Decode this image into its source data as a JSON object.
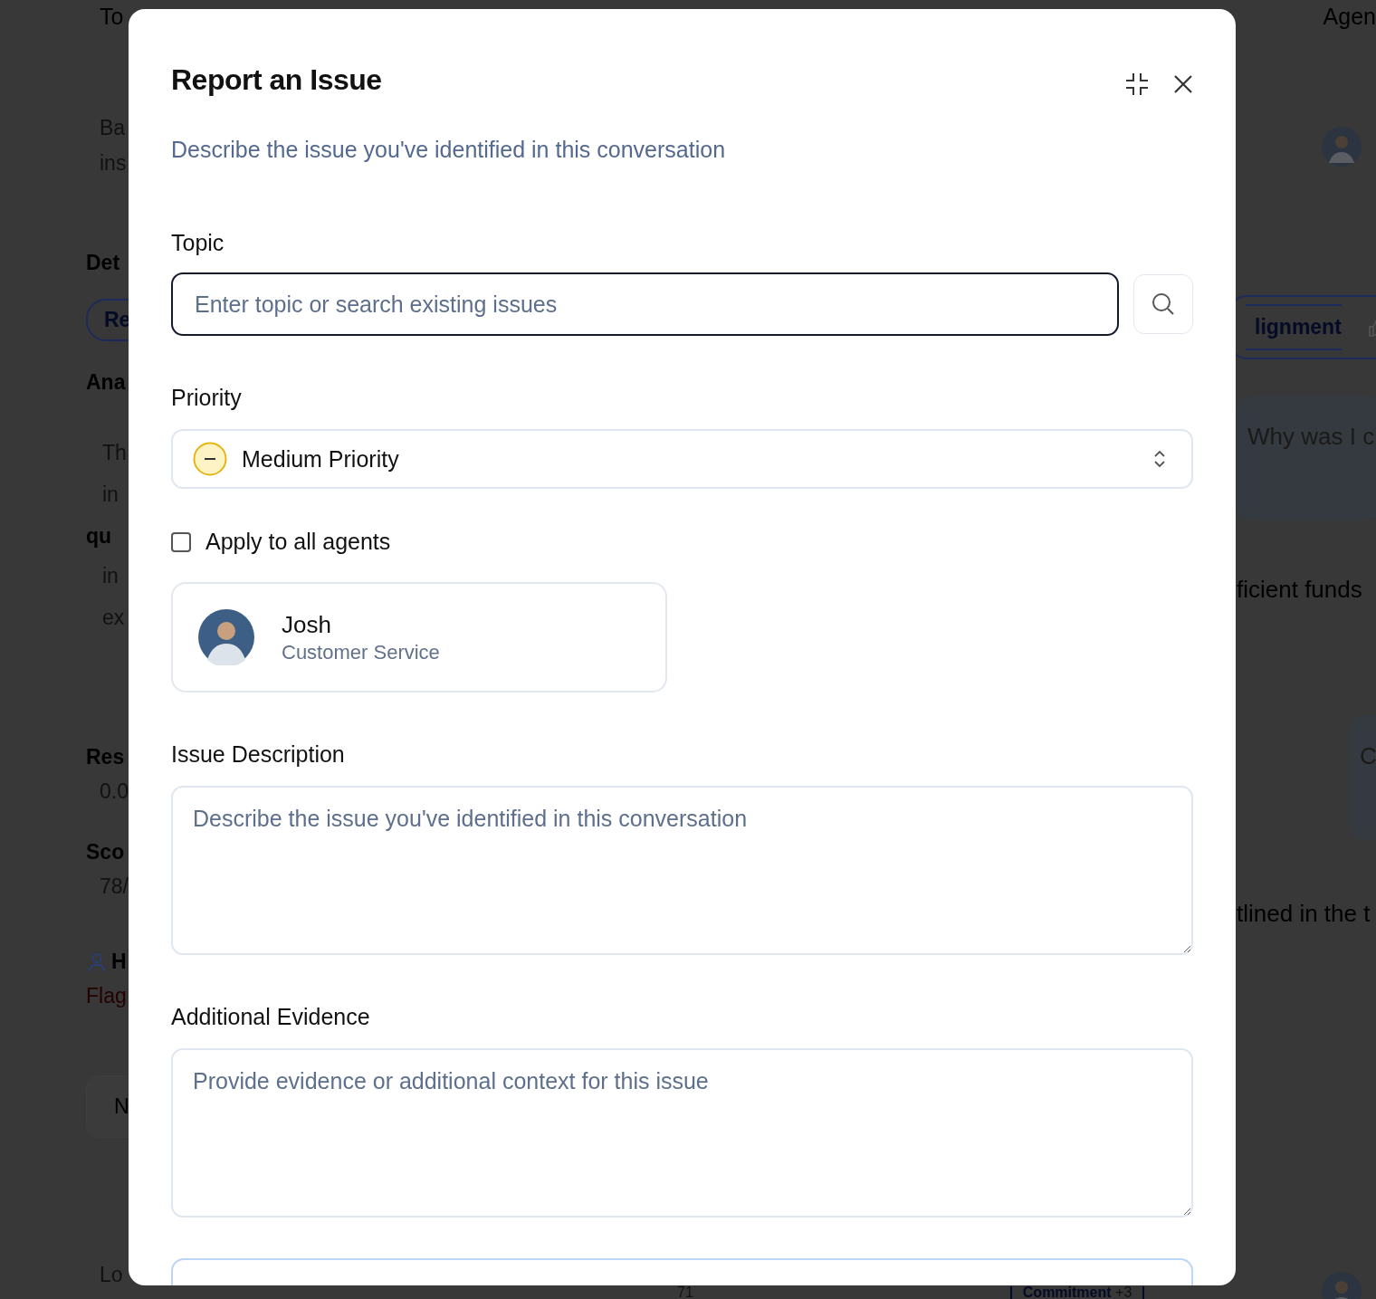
{
  "background": {
    "header": [
      {
        "text": "To"
      },
      {
        "text": "Agen"
      }
    ],
    "left": [
      {
        "text": "Ba",
        "kind": "text"
      },
      {
        "text": "ins",
        "kind": "text"
      },
      {
        "text": "Det",
        "kind": "heading"
      },
      {
        "text": "Re",
        "kind": "pill"
      },
      {
        "text": "Ana",
        "kind": "heading"
      },
      {
        "text": "Th",
        "kind": "para"
      },
      {
        "text": "in",
        "kind": "para"
      },
      {
        "text": "qu",
        "kind": "bold"
      },
      {
        "text": "in",
        "kind": "para"
      },
      {
        "text": "ex",
        "kind": "para"
      },
      {
        "text": "Res",
        "kind": "heading"
      },
      {
        "text": "0.0",
        "kind": "text"
      },
      {
        "text": "Sco",
        "kind": "heading"
      },
      {
        "text": "78/",
        "kind": "text"
      },
      {
        "text": "H",
        "kind": "person"
      },
      {
        "text": "Flag",
        "kind": "alert"
      },
      {
        "text": "N",
        "kind": "button"
      },
      {
        "text": "Lo",
        "kind": "text"
      }
    ],
    "right": [
      {
        "kind": "avatar"
      },
      {
        "text": "lignment",
        "kind": "pill"
      },
      {
        "text": "Why was I c",
        "kind": "card"
      },
      {
        "text": "ficient funds",
        "kind": "text"
      },
      {
        "text": "C",
        "kind": "card"
      },
      {
        "text": "tlined in the t",
        "kind": "text"
      },
      {
        "kind": "avatar"
      }
    ],
    "bottom": [
      {
        "text": "71",
        "kind": "text"
      },
      {
        "text": "Commitment",
        "count": "+3",
        "kind": "pill"
      }
    ]
  },
  "modal": {
    "title": "Report an Issue",
    "subtitle": "Describe the issue you've identified in this conversation",
    "topic": {
      "label": "Topic",
      "placeholder": "Enter topic or search existing issues",
      "focused": true
    },
    "priority": {
      "label": "Priority",
      "value": "Medium Priority",
      "kind": "medium"
    },
    "apply_all": {
      "label": "Apply to all agents",
      "checked": false
    },
    "agent": {
      "name": "Josh",
      "role": "Customer Service"
    },
    "description": {
      "label": "Issue Description",
      "placeholder": "Describe the issue you've identified in this conversation"
    },
    "evidence": {
      "label": "Additional Evidence",
      "placeholder": "Provide evidence or additional context for this issue"
    }
  }
}
